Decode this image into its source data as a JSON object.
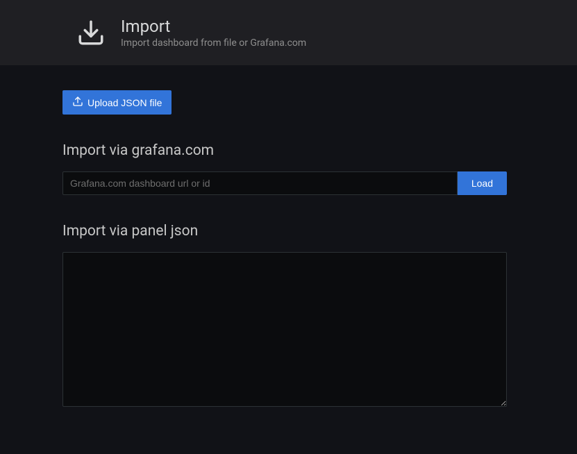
{
  "header": {
    "title": "Import",
    "subtitle": "Import dashboard from file or Grafana.com"
  },
  "buttons": {
    "upload": "Upload JSON file",
    "load": "Load"
  },
  "sections": {
    "grafana": {
      "title": "Import via grafana.com",
      "placeholder": "Grafana.com dashboard url or id"
    },
    "json": {
      "title": "Import via panel json"
    }
  }
}
